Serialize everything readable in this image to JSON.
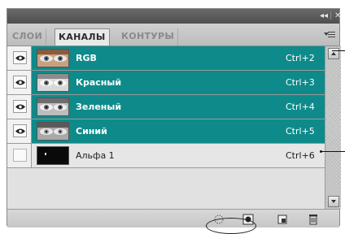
{
  "panel": {
    "topbar": {
      "collapse_glyph": "◂◂",
      "close_glyph": "✕"
    },
    "tabs": [
      {
        "label": "СЛОИ",
        "active": false
      },
      {
        "label": "КАНАЛЫ",
        "active": true
      },
      {
        "label": "КОНТУРЫ",
        "active": false
      }
    ],
    "menu_icon": "panel-menu-icon",
    "channels": [
      {
        "name": "RGB",
        "shortcut": "Ctrl+2",
        "visible": true,
        "selected": true
      },
      {
        "name": "Красный",
        "shortcut": "Ctrl+3",
        "visible": true,
        "selected": true
      },
      {
        "name": "Зеленый",
        "shortcut": "Ctrl+4",
        "visible": true,
        "selected": true
      },
      {
        "name": "Синий",
        "shortcut": "Ctrl+5",
        "visible": true,
        "selected": true
      },
      {
        "name": "Альфа 1",
        "shortcut": "Ctrl+6",
        "visible": false,
        "selected": false
      }
    ],
    "bottom_icons": [
      "load-selection-icon",
      "save-selection-icon",
      "new-channel-icon",
      "delete-icon"
    ],
    "colors": {
      "selection": "#0e8a8a",
      "panel_bg": "#d6d6d6",
      "topbar": "#555555"
    }
  }
}
